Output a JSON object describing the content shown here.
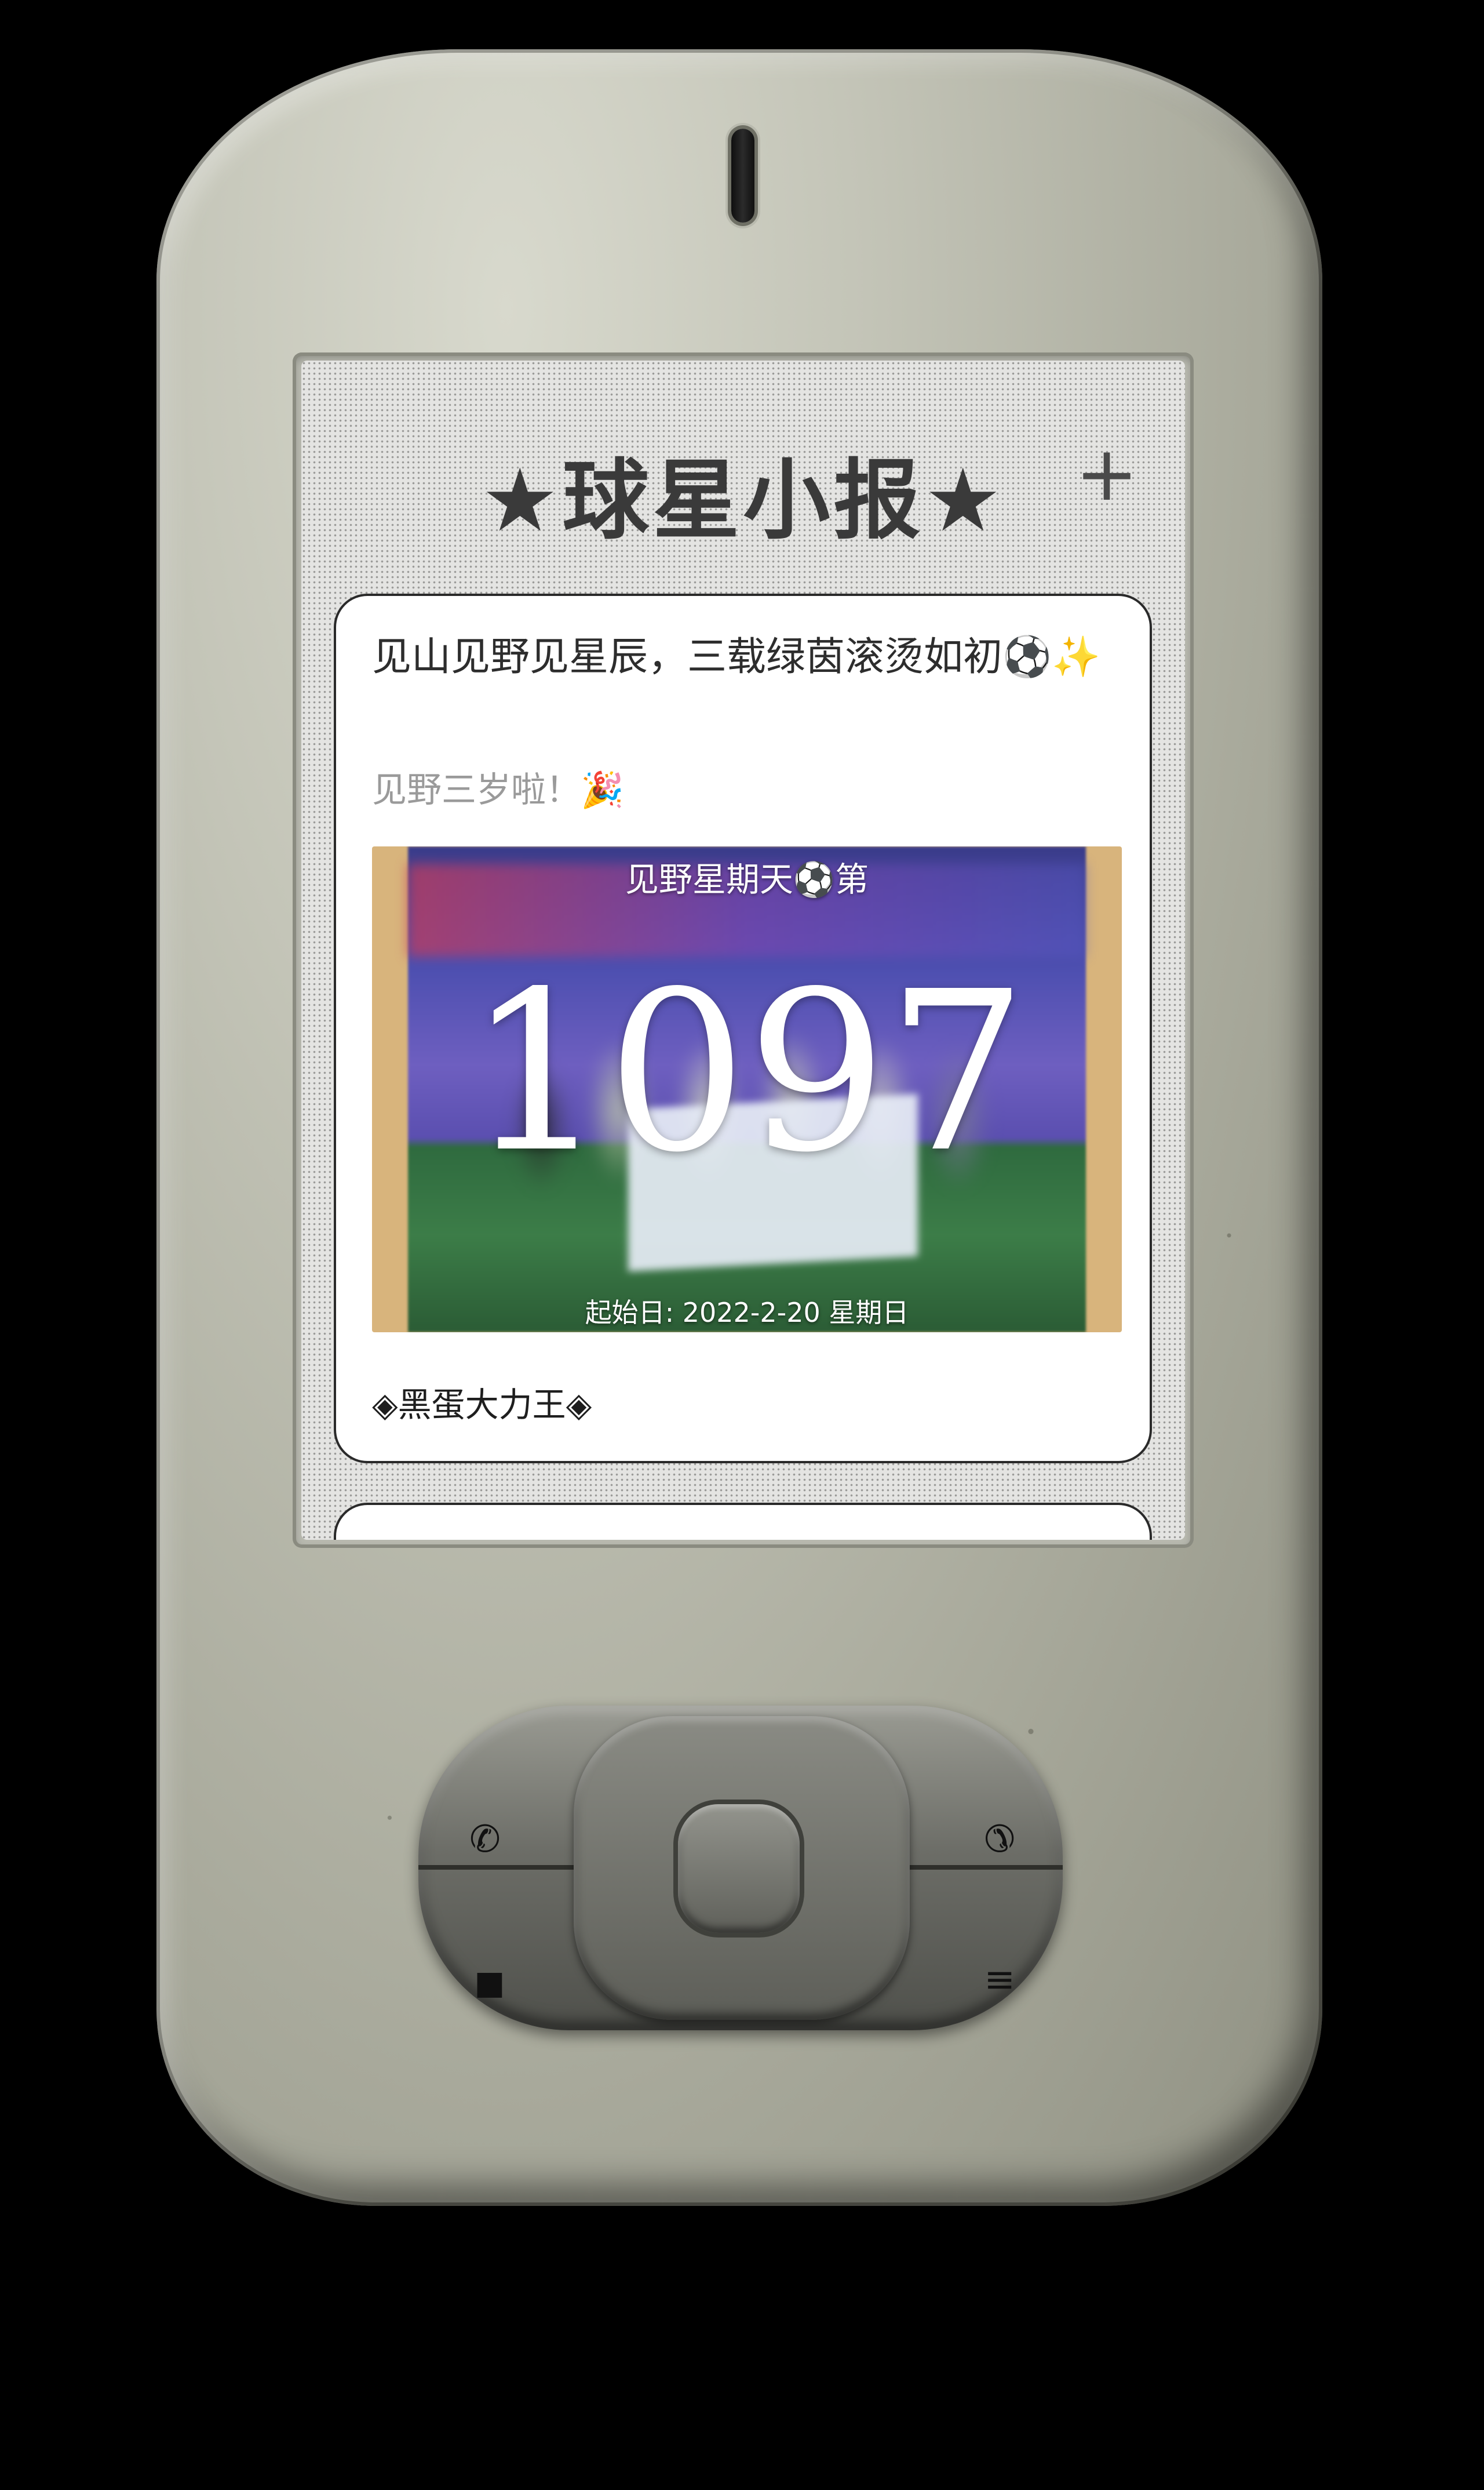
{
  "header": {
    "title": "★球星小报★",
    "add_label": "+"
  },
  "post": {
    "title": "见山见野见星辰，三载绿茵滚烫如初⚽️✨",
    "subtitle": "见野三岁啦！🎉",
    "image": {
      "caption_top": "见野星期天⚽️第",
      "day_count": "1097",
      "caption_bottom": "起始日: 2022-2-20 星期日"
    },
    "author": "◈黑蛋大力王◈"
  },
  "device_keys": {
    "call": "✆",
    "end_call": "✆",
    "left_soft": "■",
    "right_soft": "≡"
  },
  "colors": {
    "background": "#000000",
    "device_body": "#c4c5b8",
    "screen_bg": "#e4e4e2",
    "card_border": "#2a2a2a",
    "subtitle_text": "#9a9a9a"
  }
}
